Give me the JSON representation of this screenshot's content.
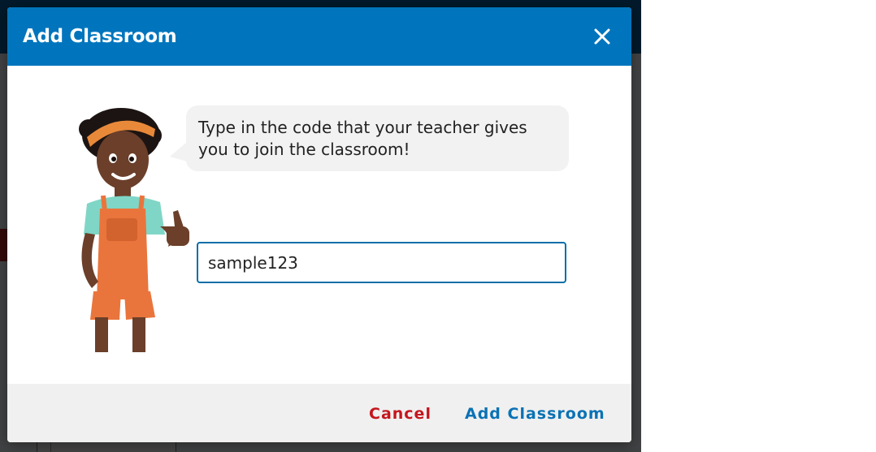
{
  "modal": {
    "title": "Add Classroom",
    "close_icon": "close-icon",
    "message": "Type in the code that your teacher gives you to join the classroom!",
    "input_value": "sample123",
    "cancel_label": "Cancel",
    "submit_label": "Add Classroom"
  },
  "colors": {
    "header": "#0075bd",
    "cancel": "#c4161c",
    "submit": "#0a72b4",
    "input_border": "#0a6ea8"
  }
}
